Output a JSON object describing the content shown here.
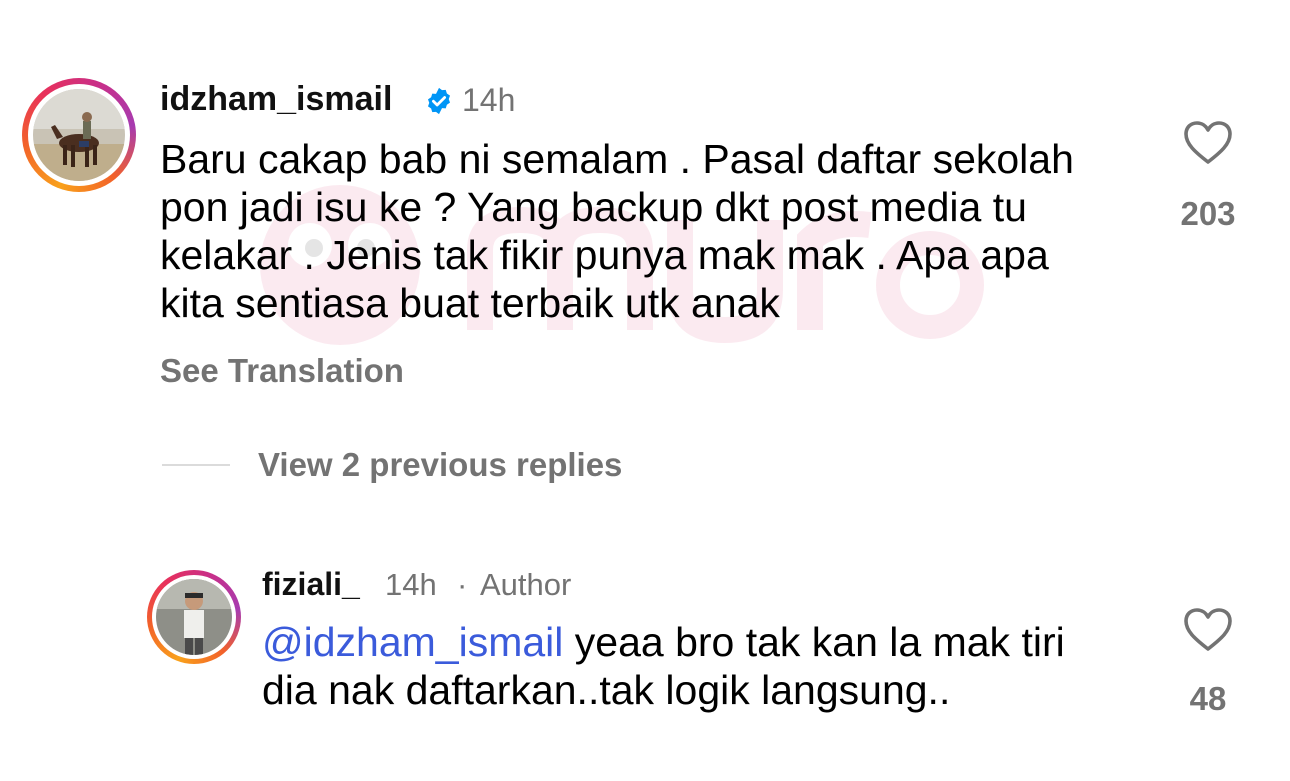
{
  "comments": [
    {
      "username": "idzham_ismail",
      "verified": true,
      "time": "14h",
      "text_lines": [
        "Baru cakap bab ni semalam . Pasal daftar sekolah",
        "pon jadi isu ke ? Yang backup dkt post media tu",
        "kelakar . Jenis tak fikir punya mak mak . Apa apa",
        "kita sentiasa buat terbaik utk anak"
      ],
      "likes": "203",
      "see_translation": "See Translation"
    },
    {
      "username": "fiziali_",
      "time": "14h",
      "separator": "·",
      "author_label": "Author",
      "mention": "@idzham_ismail",
      "text_line1_rest": " yeaa bro tak kan la mak tiri",
      "text_line2": "dia nak daftarkan..tak logik langsung..",
      "likes": "48"
    }
  ],
  "view_replies": "View 2 previous replies",
  "colors": {
    "verified_blue": "#0095f6",
    "mention": "#3b5bdb",
    "meta_gray": "#737373"
  },
  "icons": {
    "like": "heart-outline-icon",
    "verified": "verified-badge-icon"
  }
}
